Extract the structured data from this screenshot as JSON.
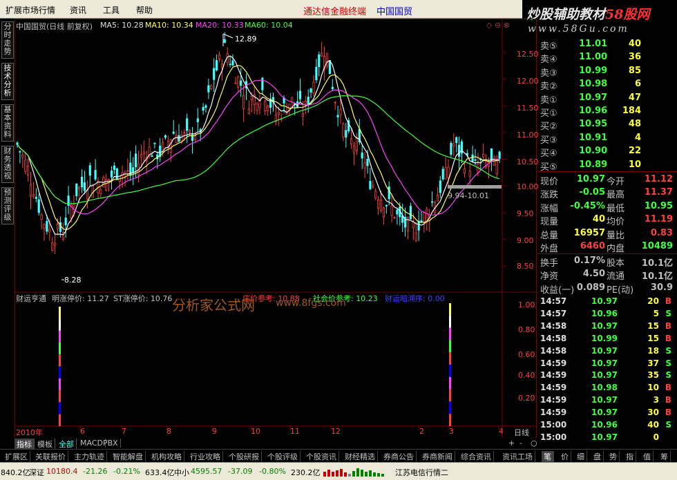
{
  "menu": {
    "items": [
      "扩展市场行情",
      "资讯",
      "工具",
      "帮助"
    ],
    "center_links": [
      "通达信金融终端",
      "中国国贸"
    ]
  },
  "brand": {
    "line1": "炒股辅助教材",
    "line1_hl": "58股网",
    "line2": "www.58Gu.com"
  },
  "left_tabs": [
    "分时走势",
    "技术分析",
    "基本资料",
    "财务透视",
    "预测评级"
  ],
  "chart_header": {
    "title": "中国国贸(日线 前复权)",
    "ma5": "MA5: 10.28",
    "ma10": "MA10: 10.34",
    "ma20": "MA20: 10.33",
    "ma60": "MA60: 10.04",
    "icons": "◇ ⊖ ⊗"
  },
  "chart_data": {
    "type": "candlestick",
    "y_ticks": [
      "12.50",
      "12.00",
      "11.50",
      "11.00",
      "10.50",
      "10.00",
      "9.50",
      "9.00",
      "8.50"
    ],
    "high_label": "12.89",
    "low_label": "8.28",
    "range_label": "9.94-10.01",
    "x_labels": [
      "2010年",
      "6",
      "7",
      "8",
      "9",
      "10",
      "11",
      "12",
      "2",
      "3",
      "4"
    ],
    "period": "日线",
    "sub_y_ticks": [
      "1.00",
      "0.80",
      "0.60",
      "0.40",
      "0.20"
    ]
  },
  "indicator": {
    "name": "财运亨通",
    "v1": "明涨停价: 11.27",
    "v2": "ST涨停价: 10.76",
    "v3": "…",
    "v4": "庄价参考: 10.88",
    "v5": "社会价参考: 10.23",
    "v6": "财运暗溯序: 0.00"
  },
  "watermark": {
    "line1": "分析家公式网",
    "line2": "www.8fgs.com"
  },
  "order_book": [
    {
      "label": "卖⑤",
      "price": "11.01",
      "vol": "40"
    },
    {
      "label": "卖④",
      "price": "11.00",
      "vol": "36"
    },
    {
      "label": "卖③",
      "price": "10.99",
      "vol": "85"
    },
    {
      "label": "卖②",
      "price": "10.98",
      "vol": "6"
    },
    {
      "label": "卖①",
      "price": "10.97",
      "vol": "47"
    },
    {
      "label": "买①",
      "price": "10.96",
      "vol": "184"
    },
    {
      "label": "买②",
      "price": "10.95",
      "vol": "48"
    },
    {
      "label": "买③",
      "price": "10.91",
      "vol": "4"
    },
    {
      "label": "买④",
      "price": "10.90",
      "vol": "22"
    },
    {
      "label": "买⑤",
      "price": "10.89",
      "vol": "10"
    }
  ],
  "quote": [
    {
      "l1": "现价",
      "v1": "10.97",
      "l2": "今开",
      "v2": "11.12"
    },
    {
      "l1": "涨跌",
      "v1": "-0.05",
      "l2": "最高",
      "v2": "11.37"
    },
    {
      "l1": "涨幅",
      "v1": "-0.45%",
      "l2": "最低",
      "v2": "10.95"
    },
    {
      "l1": "现量",
      "v1": "40",
      "l2": "均价",
      "v2": "11.19"
    },
    {
      "l1": "总量",
      "v1": "16957",
      "l2": "量比",
      "v2": "0.83"
    },
    {
      "l1": "外盘",
      "v1": "6460",
      "l2": "内盘",
      "v2": "10489"
    },
    {
      "l1": "换手",
      "v1": "0.17%",
      "l2": "股本",
      "v2": "10.1亿"
    },
    {
      "l1": "净资",
      "v1": "4.50",
      "l2": "流通",
      "v2": "10.1亿"
    },
    {
      "l1": "收益(一)",
      "v1": "0.089",
      "l2": "PE(动)",
      "v2": "30.9"
    }
  ],
  "ticks": [
    {
      "t": "14:57",
      "p": "10.97",
      "v": "20",
      "s": "B"
    },
    {
      "t": "14:57",
      "p": "10.96",
      "v": "5",
      "s": "S"
    },
    {
      "t": "14:58",
      "p": "10.97",
      "v": "15",
      "s": "B"
    },
    {
      "t": "14:58",
      "p": "10.99",
      "v": "15",
      "s": "B"
    },
    {
      "t": "14:58",
      "p": "10.97",
      "v": "18",
      "s": "S"
    },
    {
      "t": "14:59",
      "p": "10.97",
      "v": "37",
      "s": "S"
    },
    {
      "t": "14:59",
      "p": "10.97",
      "v": "35",
      "s": "S"
    },
    {
      "t": "14:59",
      "p": "10.98",
      "v": "10",
      "s": "B"
    },
    {
      "t": "14:59",
      "p": "10.97",
      "v": "3",
      "s": "B"
    },
    {
      "t": "14:59",
      "p": "10.97",
      "v": "30",
      "s": "B"
    },
    {
      "t": "15:00",
      "p": "10.96",
      "v": "40",
      "s": "S"
    },
    {
      "t": "15:00",
      "p": "10.97",
      "v": "0",
      "s": ""
    }
  ],
  "sub_tabs": [
    "指标",
    "模板",
    "全部",
    "MACD",
    "PBX"
  ],
  "bottom_tabs": [
    "扩展区",
    "关联报价",
    "主力轨迹",
    "智能解盘",
    "机构攻略",
    "行业攻略",
    "个股研报",
    "个股评级",
    "个股资讯",
    "财经精选",
    "券商公告",
    "券商新闻",
    "综合资讯",
    "资讯工场"
  ],
  "right_tabs": [
    "笔",
    "价",
    "细",
    "盘",
    "势",
    "指",
    "值",
    "筹"
  ],
  "status": {
    "sh": "840.2亿",
    "sz_label": "深证",
    "sz_val": "10180.4",
    "sz_chg": "-21.26",
    "sz_pct": "-0.21%",
    "sz_amt": "633.4亿",
    "zx_label": "中小",
    "zx_val": "4595.57",
    "zx_chg": "-37.09",
    "zx_pct": "-0.80%",
    "zx_amt": "230.2亿",
    "net": "江苏电信行情二"
  }
}
